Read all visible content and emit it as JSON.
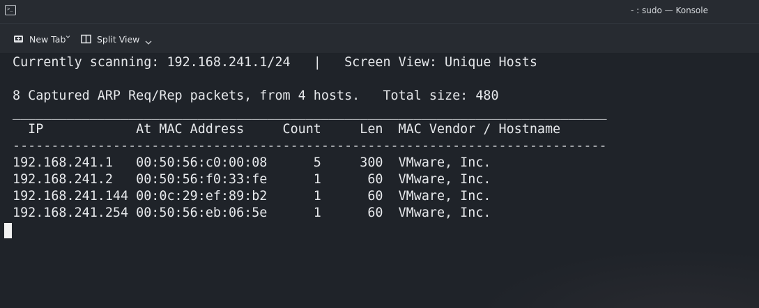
{
  "window": {
    "title": "- : sudo — Konsole",
    "icon": "terminal-app-icon"
  },
  "toolbar": {
    "new_tab_label": "New Tab",
    "new_tab_icon": "new-tab-icon",
    "split_view_label": "Split View",
    "split_view_icon": "split-view-icon"
  },
  "terminal": {
    "lines": [
      "Currently scanning: 192.168.241.1/24   |   Screen View: Unique Hosts",
      "",
      "8 Captured ARP Req/Rep packets, from 4 hosts.   Total size: 480",
      "_____________________________________________________________________________",
      "  IP            At MAC Address     Count     Len  MAC Vendor / Hostname",
      "-----------------------------------------------------------------------------",
      "192.168.241.1   00:50:56:c0:00:08      5     300  VMware, Inc.",
      "192.168.241.2   00:50:56:f0:33:fe      1      60  VMware, Inc.",
      "192.168.241.144 00:0c:29:ef:89:b2      1      60  VMware, Inc.",
      "192.168.241.254 00:50:56:eb:06:5e      1      60  VMware, Inc."
    ]
  },
  "colors": {
    "background": "#1f2329",
    "chrome": "#272b31",
    "text": "#e6e8eb"
  }
}
